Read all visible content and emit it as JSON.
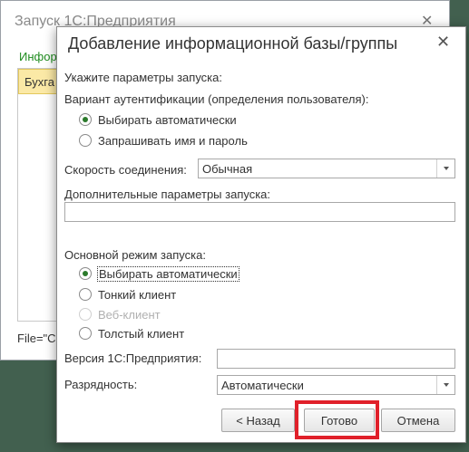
{
  "background_window": {
    "title": "Запуск 1С:Предприятия",
    "section_label": "Инфор",
    "list_item": "Бухга",
    "path_text": "File=\"C"
  },
  "dialog": {
    "title": "Добавление информационной базы/группы",
    "prompt": "Укажите параметры запуска:",
    "auth_label": "Вариант аутентификации (определения пользователя):",
    "auth_options": [
      {
        "label": "Выбирать автоматически",
        "checked": true
      },
      {
        "label": "Запрашивать имя и пароль",
        "checked": false
      }
    ],
    "speed_label": "Скорость соединения:",
    "speed_value": "Обычная",
    "extra_params_label": "Дополнительные параметры запуска:",
    "extra_params_value": "",
    "mode_label": "Основной режим запуска:",
    "mode_options": [
      {
        "label": "Выбирать автоматически",
        "checked": true,
        "disabled": false
      },
      {
        "label": "Тонкий клиент",
        "checked": false,
        "disabled": false
      },
      {
        "label": "Веб-клиент",
        "checked": false,
        "disabled": true
      },
      {
        "label": "Толстый клиент",
        "checked": false,
        "disabled": false
      }
    ],
    "version_label": "Версия 1С:Предприятия:",
    "version_value": "",
    "bitness_label": "Разрядность:",
    "bitness_value": "Автоматически",
    "buttons": {
      "back": "< Назад",
      "done": "Готово",
      "cancel": "Отмена"
    }
  },
  "colors": {
    "desktop": "#42604f",
    "accent_green": "#1f8c1f",
    "highlight_red": "#e0202a"
  },
  "icons": {
    "close": "close-icon",
    "dropdown": "chevron-down-icon"
  }
}
